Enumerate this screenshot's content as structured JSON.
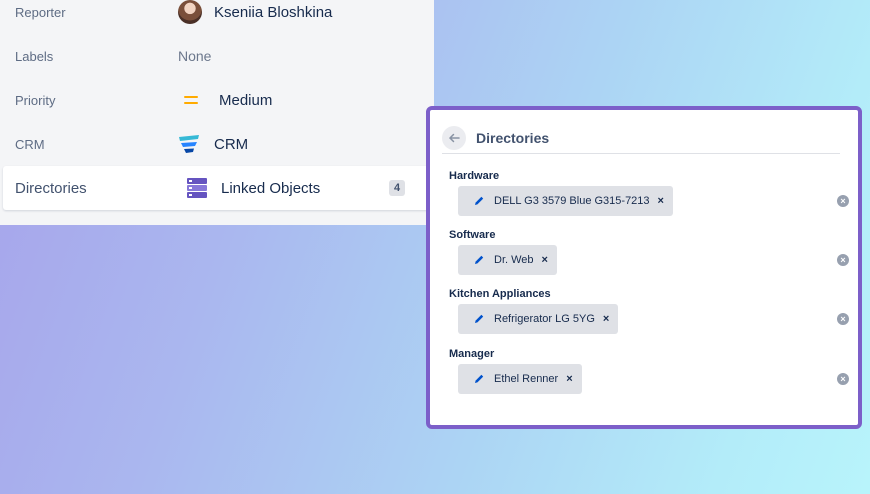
{
  "details": {
    "rows": [
      {
        "label": "Reporter",
        "value": "Kseniia Bloshkina"
      },
      {
        "label": "Labels",
        "value": "None"
      },
      {
        "label": "Priority",
        "value": "Medium"
      },
      {
        "label": "CRM",
        "value": "CRM"
      },
      {
        "label": "Directories",
        "value": "Linked Objects",
        "count": "4"
      }
    ]
  },
  "popup": {
    "title": "Directories",
    "groups": [
      {
        "label": "Hardware",
        "chip": "DELL G3 3579 Blue G315-7213"
      },
      {
        "label": "Software",
        "chip": "Dr. Web"
      },
      {
        "label": "Kitchen Appliances",
        "chip": "Refrigerator LG 5YG"
      },
      {
        "label": "Manager",
        "chip": "Ethel Renner"
      }
    ],
    "remove_glyph": "×",
    "clear_glyph": "×"
  },
  "colors": {
    "accent_border": "#7c5fc9",
    "priority_medium": "#ffab00",
    "edit_icon": "#0052cc"
  },
  "icons": {
    "reporter_avatar": "avatar",
    "priority": "medium-priority-icon",
    "crm": "crm-funnel-icon",
    "directories": "linked-objects-icon",
    "back": "arrow-left-icon",
    "edit": "pencil-icon",
    "remove": "close-icon",
    "clear": "clear-circle-icon"
  }
}
